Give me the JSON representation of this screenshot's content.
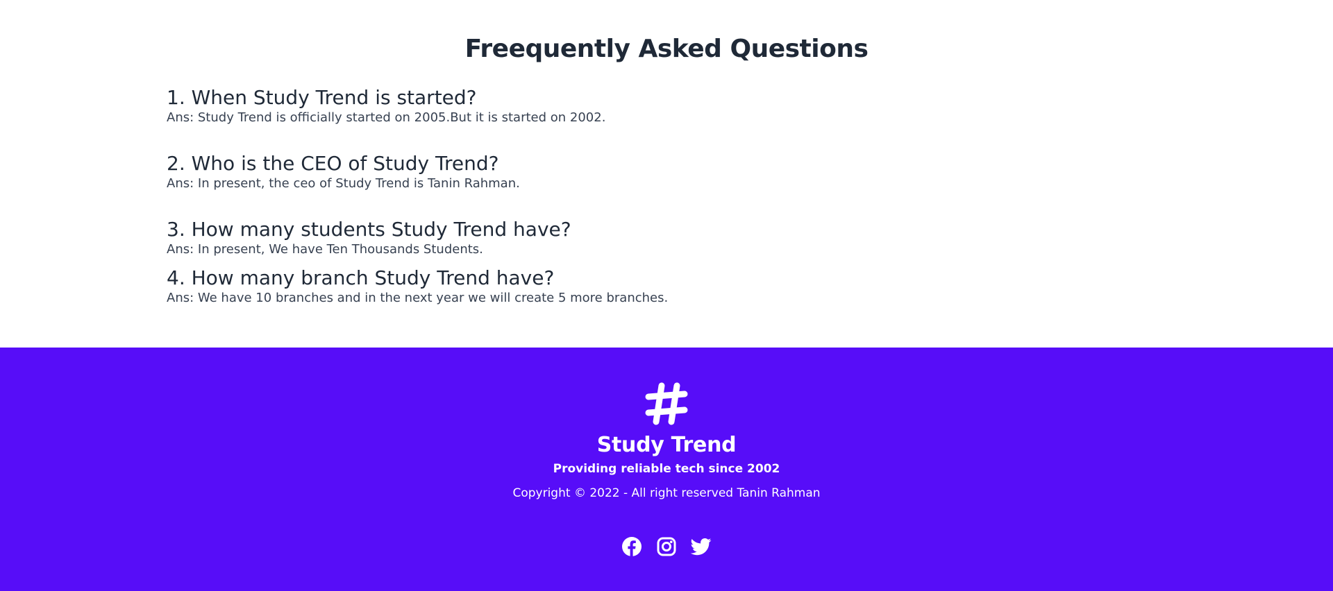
{
  "faq": {
    "title": "Freequently Asked Questions",
    "items": [
      {
        "question": "1. When Study Trend is started?",
        "answer": "Ans: Study Trend is officially started on 2005.But it is started on 2002."
      },
      {
        "question": "2. Who is the CEO of Study Trend?",
        "answer": "Ans: In present, the ceo of Study Trend is Tanin Rahman."
      },
      {
        "question": "3. How many students Study Trend have?",
        "answer": "Ans: In present, We have Ten Thousands Students."
      },
      {
        "question": "4. How many branch Study Trend have?",
        "answer": "Ans: We have 10 branches and in the next year we will create 5 more branches."
      }
    ]
  },
  "footer": {
    "logo_icon": "hashtag-icon",
    "brand_name": "Study Trend",
    "tagline": "Providing reliable tech since 2002",
    "copyright": "Copyright © 2022 - All right reserved Tanin Rahman",
    "social": [
      {
        "icon": "facebook-icon"
      },
      {
        "icon": "instagram-icon"
      },
      {
        "icon": "twitter-icon"
      }
    ]
  },
  "colors": {
    "footer_background": "#570df8",
    "heading_text": "#1f2937",
    "body_text": "#374151",
    "footer_text": "#ffffff"
  }
}
